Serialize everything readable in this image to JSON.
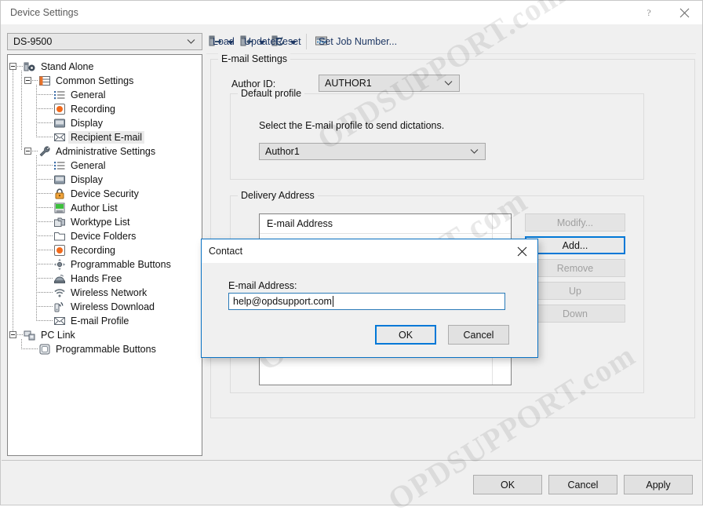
{
  "window": {
    "title": "Device Settings",
    "help_icon": "question-mark-icon",
    "close_icon": "close-icon"
  },
  "device_selector": {
    "value": "DS-9500",
    "icon": "chevron-down-icon"
  },
  "toolbar": {
    "items": [
      {
        "label": "Load",
        "icon": "load-icon",
        "has_dropdown": true
      },
      {
        "label": "Update",
        "icon": "update-icon",
        "has_dropdown": true
      },
      {
        "label": "Reset",
        "icon": "reset-icon",
        "has_dropdown": true
      },
      {
        "label": "Set Job Number...",
        "icon": "set-job-number-icon",
        "has_dropdown": false
      }
    ]
  },
  "tree": {
    "nodes": [
      {
        "label": "Stand Alone",
        "depth": 0,
        "icon": "device-gear-icon",
        "expander": "minus",
        "selected": false
      },
      {
        "label": "Common Settings",
        "depth": 1,
        "icon": "list-grid-icon",
        "expander": "minus",
        "selected": false
      },
      {
        "label": "General",
        "depth": 2,
        "icon": "bullet-list-icon",
        "expander": "none",
        "selected": false
      },
      {
        "label": "Recording",
        "depth": 2,
        "icon": "record-dot-icon",
        "expander": "none",
        "selected": false
      },
      {
        "label": "Display",
        "depth": 2,
        "icon": "monitor-icon",
        "expander": "none",
        "selected": false
      },
      {
        "label": "Recipient E-mail",
        "depth": 2,
        "icon": "envelope-icon",
        "expander": "none",
        "selected": true
      },
      {
        "label": "Administrative Settings",
        "depth": 1,
        "icon": "wrench-icon",
        "expander": "minus",
        "selected": false
      },
      {
        "label": "General",
        "depth": 2,
        "icon": "bullet-list-icon",
        "expander": "none",
        "selected": false
      },
      {
        "label": "Display",
        "depth": 2,
        "icon": "monitor-icon",
        "expander": "none",
        "selected": false
      },
      {
        "label": "Device Security",
        "depth": 2,
        "icon": "lock-icon",
        "expander": "none",
        "selected": false
      },
      {
        "label": "Author List",
        "depth": 2,
        "icon": "author-card-icon",
        "expander": "none",
        "selected": false
      },
      {
        "label": "Worktype List",
        "depth": 2,
        "icon": "worktype-folders-icon",
        "expander": "none",
        "selected": false
      },
      {
        "label": "Device Folders",
        "depth": 2,
        "icon": "folder-icon",
        "expander": "none",
        "selected": false
      },
      {
        "label": "Recording",
        "depth": 2,
        "icon": "record-dot-icon",
        "expander": "none",
        "selected": false
      },
      {
        "label": "Programmable Buttons",
        "depth": 2,
        "icon": "dpad-icon",
        "expander": "none",
        "selected": false
      },
      {
        "label": "Hands Free",
        "depth": 2,
        "icon": "hands-free-icon",
        "expander": "none",
        "selected": false
      },
      {
        "label": "Wireless Network",
        "depth": 2,
        "icon": "wifi-icon",
        "expander": "none",
        "selected": false
      },
      {
        "label": "Wireless Download",
        "depth": 2,
        "icon": "wireless-download-icon",
        "expander": "none",
        "selected": false
      },
      {
        "label": "E-mail Profile",
        "depth": 2,
        "icon": "envelope-icon",
        "expander": "none",
        "selected": false
      },
      {
        "label": "PC Link",
        "depth": 0,
        "icon": "pc-link-icon",
        "expander": "minus",
        "selected": false
      },
      {
        "label": "Programmable Buttons",
        "depth": 1,
        "icon": "button-square-icon",
        "expander": "none",
        "selected": false
      }
    ]
  },
  "email_settings": {
    "caption": "E-mail Settings",
    "author_id_label": "Author ID:",
    "author_id_value": "AUTHOR1",
    "default_profile": {
      "caption": "Default profile",
      "description": "Select the E-mail profile to send dictations.",
      "value": "Author1"
    },
    "delivery_address": {
      "caption": "Delivery Address",
      "column_header": "E-mail Address",
      "rows": [],
      "buttons": [
        {
          "label": "Modify...",
          "state": "disabled"
        },
        {
          "label": "Add...",
          "state": "focused"
        },
        {
          "label": "Remove",
          "state": "disabled"
        },
        {
          "label": "Up",
          "state": "disabled"
        },
        {
          "label": "Down",
          "state": "disabled"
        }
      ]
    }
  },
  "footer": {
    "ok": "OK",
    "cancel": "Cancel",
    "apply": "Apply"
  },
  "dialog": {
    "title": "Contact",
    "close_icon": "close-icon",
    "field_label": "E-mail Address:",
    "field_value": "help@opdsupport.com",
    "ok": "OK",
    "cancel": "Cancel"
  },
  "watermark": {
    "text": "OPDSUPPORT.com"
  }
}
